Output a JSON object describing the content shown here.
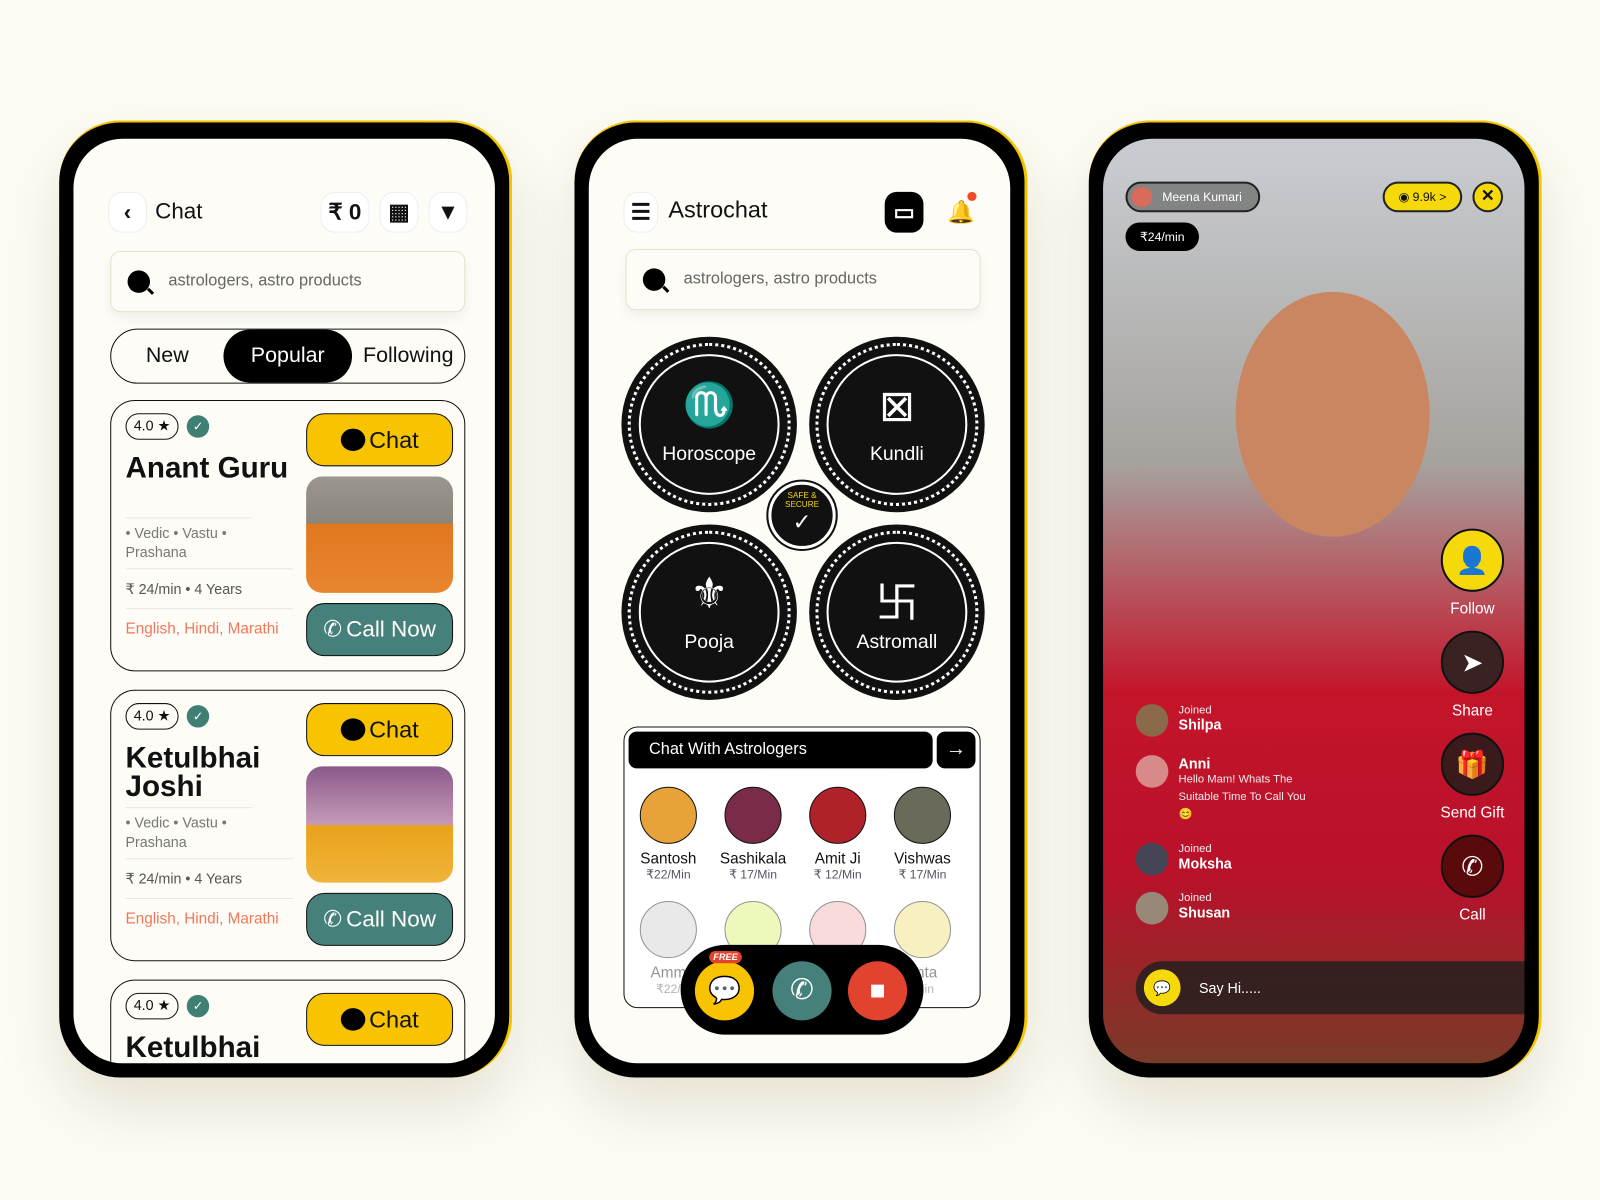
{
  "screen1": {
    "title": "Chat",
    "wallet": "₹ 0",
    "search_placeholder": "astrologers, astro products",
    "tabs": [
      "New",
      "Popular",
      "Following"
    ],
    "active_tab": "Popular",
    "cards": [
      {
        "rating": "4.0 ★",
        "name": "Anant Guru",
        "skills": "• Vedic • Vastu • Prashana",
        "price": "₹ 24/min • 4 Years",
        "languages": "English, Hindi, Marathi",
        "chat": "Chat",
        "call": "Call Now"
      },
      {
        "rating": "4.0 ★",
        "name": "Ketulbhai Joshi",
        "skills": "• Vedic • Vastu • Prashana",
        "price": "₹ 24/min • 4 Years",
        "languages": "English, Hindi, Marathi",
        "chat": "Chat",
        "call": "Call Now"
      },
      {
        "rating": "4.0 ★",
        "name": "Ketulbhai",
        "chat": "Chat"
      }
    ]
  },
  "screen2": {
    "title": "Astrochat",
    "search_placeholder": "astrologers, astro products",
    "services": [
      "Horoscope",
      "Kundli",
      "Pooja",
      "Astromall"
    ],
    "badge": "SAFE & SECURE",
    "section_title": "Chat With Astrologers",
    "arrow": "→",
    "astrologers": [
      {
        "name": "Santosh",
        "price": "₹22/Min"
      },
      {
        "name": "Sashikala",
        "price": "₹ 17/Min"
      },
      {
        "name": "Amit Ji",
        "price": "₹ 12/Min"
      },
      {
        "name": "Vishwas",
        "price": "₹ 17/Min"
      },
      {
        "name": "Amm",
        "price": "₹22/"
      },
      {
        "name": "",
        "price": ""
      },
      {
        "name": "",
        "price": ""
      },
      {
        "name": "anta",
        "price": "/Min"
      }
    ],
    "free_badge": "FREE",
    "accent": "#f8c300",
    "call_color": "#46807a",
    "video_color": "#e2432f"
  },
  "screen3": {
    "host": "Meena Kumari",
    "rate": "₹24/min",
    "viewers": "9.9k",
    "viewers_arrow": ">",
    "actions": [
      "Follow",
      "Share",
      "Send Gift",
      "Call"
    ],
    "feed": [
      {
        "label": "Joined",
        "name": "Shilpa"
      },
      {
        "label": "",
        "name": "Anni",
        "message": "Hello Mam! Whats The Suitable Time To Call You 😊"
      },
      {
        "label": "Joined",
        "name": "Moksha"
      },
      {
        "label": "Joined",
        "name": "Shusan"
      }
    ],
    "input_placeholder": "Say Hi.....",
    "accent": "#f5d90a"
  }
}
